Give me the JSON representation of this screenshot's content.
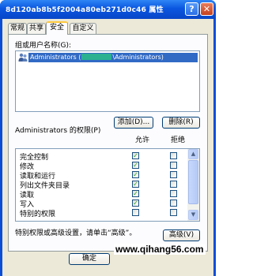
{
  "window": {
    "title": "8d120ab8b5f2004a80eb271d0c46 属性",
    "help_button": "?",
    "close_button": "✕"
  },
  "tabs": [
    {
      "label": "常规"
    },
    {
      "label": "共享"
    },
    {
      "label": "安全"
    },
    {
      "label": "自定义"
    }
  ],
  "security": {
    "users_label": "组或用户名称(G):",
    "users": [
      {
        "name_prefix": "Administrators (",
        "name_suffix": "\\Administrators)",
        "icon": "user-group-icon"
      }
    ],
    "add_button": "添加(D)...",
    "remove_button": "删除(R)",
    "permissions_label": "Administrators 的权限(P)",
    "allow_header": "允许",
    "deny_header": "拒绝",
    "permissions": [
      {
        "name": "完全控制",
        "allow": true,
        "deny": false
      },
      {
        "name": "修改",
        "allow": true,
        "deny": false
      },
      {
        "name": "读取和运行",
        "allow": true,
        "deny": false
      },
      {
        "name": "列出文件夹目录",
        "allow": true,
        "deny": false
      },
      {
        "name": "读取",
        "allow": true,
        "deny": false
      },
      {
        "name": "写入",
        "allow": true,
        "deny": false
      },
      {
        "name": "特别的权限",
        "allow": false,
        "deny": false
      }
    ],
    "advanced_hint": "特别权限或高级设置，请单击“高级”。",
    "advanced_button": "高级(V)"
  },
  "footer": {
    "ok_button": "确定"
  },
  "watermark": "www.qihang56.com",
  "colors": {
    "titlebar": "#0a56e0",
    "selection": "#316ac5",
    "dialog_bg": "#ece9d8",
    "check": "#21a121"
  }
}
